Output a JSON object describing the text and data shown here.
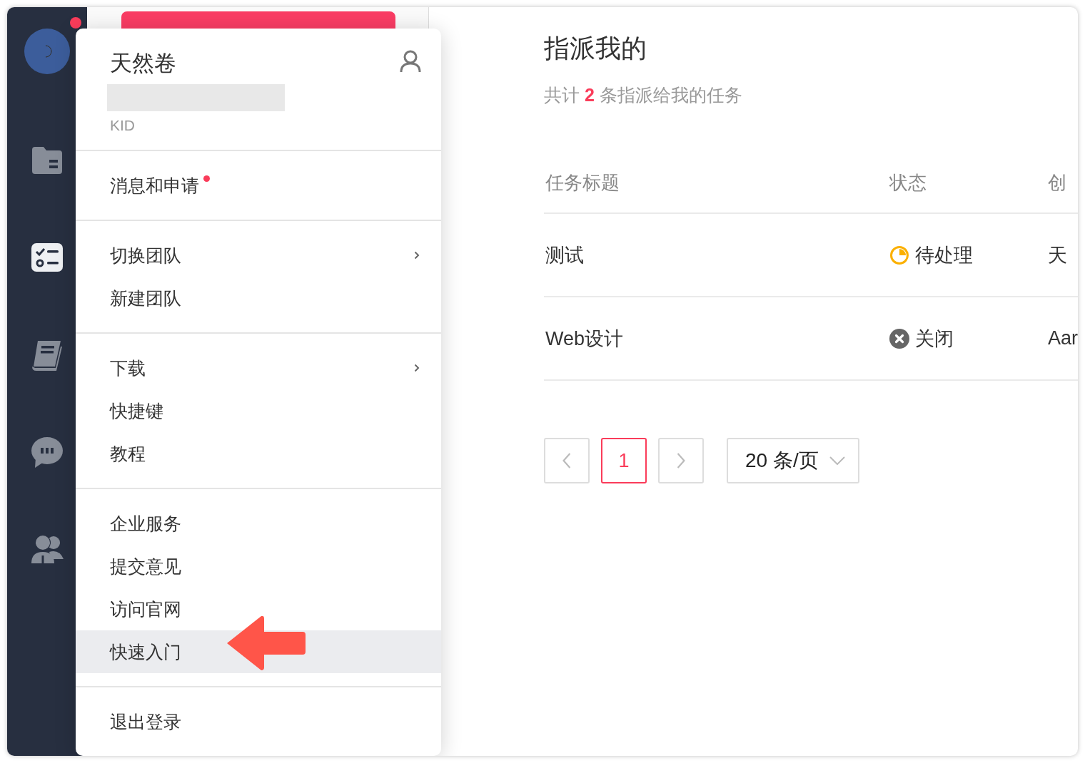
{
  "sidebar": {
    "notification_dot": true,
    "items": [
      {
        "kind": "folder",
        "selected": false
      },
      {
        "kind": "tasks",
        "selected": true
      },
      {
        "kind": "book",
        "selected": false
      },
      {
        "kind": "chat",
        "selected": false
      },
      {
        "kind": "people",
        "selected": false
      }
    ]
  },
  "account_menu": {
    "name": "天然卷",
    "subtitle": "KID",
    "groups": [
      [
        {
          "label": "消息和申请",
          "badge": true,
          "submenu": false,
          "selected": false
        }
      ],
      [
        {
          "label": "切换团队",
          "badge": false,
          "submenu": true,
          "selected": false
        },
        {
          "label": "新建团队",
          "badge": false,
          "submenu": false,
          "selected": false
        }
      ],
      [
        {
          "label": "下载",
          "badge": false,
          "submenu": true,
          "selected": false
        },
        {
          "label": "快捷键",
          "badge": false,
          "submenu": false,
          "selected": false
        },
        {
          "label": "教程",
          "badge": false,
          "submenu": false,
          "selected": false
        }
      ],
      [
        {
          "label": "企业服务",
          "badge": false,
          "submenu": false,
          "selected": false
        },
        {
          "label": "提交意见",
          "badge": false,
          "submenu": false,
          "selected": false
        },
        {
          "label": "访问官网",
          "badge": false,
          "submenu": false,
          "selected": false
        },
        {
          "label": "快速入门",
          "badge": false,
          "submenu": false,
          "selected": true
        }
      ],
      [
        {
          "label": "退出登录",
          "badge": false,
          "submenu": false,
          "selected": false
        }
      ]
    ]
  },
  "page": {
    "title": "指派我的",
    "summary": "共计 **2** 条指派给我的任务"
  },
  "table": {
    "columns": [
      "任务标题",
      "状态",
      "创"
    ],
    "rows": [
      {
        "title": "测试",
        "status": {
          "kind": "pending",
          "label": "待处理"
        },
        "column_3": "天"
      },
      {
        "title": "Web设计",
        "status": {
          "kind": "closed",
          "label": "关闭"
        },
        "column_3": "Aar"
      }
    ]
  },
  "pagination": {
    "pages": [
      {
        "label": "1",
        "selected": true
      }
    ],
    "page_size": "20 条/页"
  }
}
